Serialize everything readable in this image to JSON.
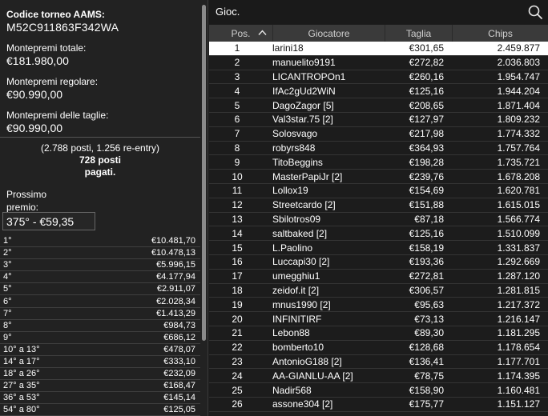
{
  "left": {
    "code_label": "Codice torneo AAMS:",
    "code_value": "M52C911863F342WA",
    "total_label": "Montepremi totale:",
    "total_value": "€181.980,00",
    "regular_label": "Montepremi regolare:",
    "regular_value": "€90.990,00",
    "bounty_label": "Montepremi delle taglie:",
    "bounty_value": "€90.990,00",
    "entries_line": "(2.788 posti, 1.256 re-entry)",
    "paid_line1": "728 posti",
    "paid_line2": "pagati.",
    "next_label": "Prossimo premio:",
    "next_value": "375° - €59,35",
    "prizes": [
      {
        "place": "1°",
        "amount": "€10.481,70"
      },
      {
        "place": "2°",
        "amount": "€10.478,13"
      },
      {
        "place": "3°",
        "amount": "€5.996,15"
      },
      {
        "place": "4°",
        "amount": "€4.177,94"
      },
      {
        "place": "5°",
        "amount": "€2.911,07"
      },
      {
        "place": "6°",
        "amount": "€2.028,34"
      },
      {
        "place": "7°",
        "amount": "€1.413,29"
      },
      {
        "place": "8°",
        "amount": "€984,73"
      },
      {
        "place": "9°",
        "amount": "€686,12"
      },
      {
        "place": "10° a 13°",
        "amount": "€478,07"
      },
      {
        "place": "14° a 17°",
        "amount": "€333,10"
      },
      {
        "place": "18° a 26°",
        "amount": "€232,09"
      },
      {
        "place": "27° a 35°",
        "amount": "€168,47"
      },
      {
        "place": "36° a 53°",
        "amount": "€145,14"
      },
      {
        "place": "54° a 80°",
        "amount": "€125,05"
      }
    ]
  },
  "right": {
    "tab_title": "Gioc.",
    "columns": {
      "pos": "Pos.",
      "player": "Giocatore",
      "size": "Taglia",
      "chips": "Chips"
    },
    "selected_row": 1,
    "rows": [
      {
        "pos": "1",
        "player": "larini18",
        "size": "€301,65",
        "chips": "2.459.877"
      },
      {
        "pos": "2",
        "player": "manuelito9191",
        "size": "€272,82",
        "chips": "2.036.803"
      },
      {
        "pos": "3",
        "player": "LICANTROPOn1",
        "size": "€260,16",
        "chips": "1.954.747"
      },
      {
        "pos": "4",
        "player": "IfAc2gUd2WiN",
        "size": "€125,16",
        "chips": "1.944.204"
      },
      {
        "pos": "5",
        "player": "DagoZagor [5]",
        "size": "€208,65",
        "chips": "1.871.404"
      },
      {
        "pos": "6",
        "player": "Val3star.75 [2]",
        "size": "€127,97",
        "chips": "1.809.232"
      },
      {
        "pos": "7",
        "player": "Solosvago",
        "size": "€217,98",
        "chips": "1.774.332"
      },
      {
        "pos": "8",
        "player": "robyrs848",
        "size": "€364,93",
        "chips": "1.757.764"
      },
      {
        "pos": "9",
        "player": "TitoBeggins",
        "size": "€198,28",
        "chips": "1.735.721"
      },
      {
        "pos": "10",
        "player": "MasterPapiJr [2]",
        "size": "€239,76",
        "chips": "1.678.208"
      },
      {
        "pos": "11",
        "player": "Lollox19",
        "size": "€154,69",
        "chips": "1.620.781"
      },
      {
        "pos": "12",
        "player": "Streetcardo [2]",
        "size": "€151,88",
        "chips": "1.615.015"
      },
      {
        "pos": "13",
        "player": "Sbilotros09",
        "size": "€87,18",
        "chips": "1.566.774"
      },
      {
        "pos": "14",
        "player": "saltbaked [2]",
        "size": "€125,16",
        "chips": "1.510.099"
      },
      {
        "pos": "15",
        "player": "L.Paolino",
        "size": "€158,19",
        "chips": "1.331.837"
      },
      {
        "pos": "16",
        "player": "Luccapi30 [2]",
        "size": "€193,36",
        "chips": "1.292.669"
      },
      {
        "pos": "17",
        "player": "umegghiu1",
        "size": "€272,81",
        "chips": "1.287.120"
      },
      {
        "pos": "18",
        "player": "zeidof.it [2]",
        "size": "€306,57",
        "chips": "1.281.815"
      },
      {
        "pos": "19",
        "player": "mnus1990 [2]",
        "size": "€95,63",
        "chips": "1.217.372"
      },
      {
        "pos": "20",
        "player": "INFINITIRF",
        "size": "€73,13",
        "chips": "1.216.147"
      },
      {
        "pos": "21",
        "player": "Lebon88",
        "size": "€89,30",
        "chips": "1.181.295"
      },
      {
        "pos": "22",
        "player": "bomberto10",
        "size": "€128,68",
        "chips": "1.178.654"
      },
      {
        "pos": "23",
        "player": "AntonioG188 [2]",
        "size": "€136,41",
        "chips": "1.177.701"
      },
      {
        "pos": "24",
        "player": "AA-GIANLU-AA [2]",
        "size": "€78,75",
        "chips": "1.174.395"
      },
      {
        "pos": "25",
        "player": "Nadir568",
        "size": "€158,90",
        "chips": "1.160.481"
      },
      {
        "pos": "26",
        "player": "assone304 [2]",
        "size": "€175,77",
        "chips": "1.151.127"
      }
    ]
  },
  "icons": {
    "search": "search-icon",
    "sort": "chevron-up-icon"
  },
  "colors": {
    "selected_row_bg": "#ffffff",
    "header_bg": "#3a3a3a",
    "panel_bg": "#222222"
  }
}
